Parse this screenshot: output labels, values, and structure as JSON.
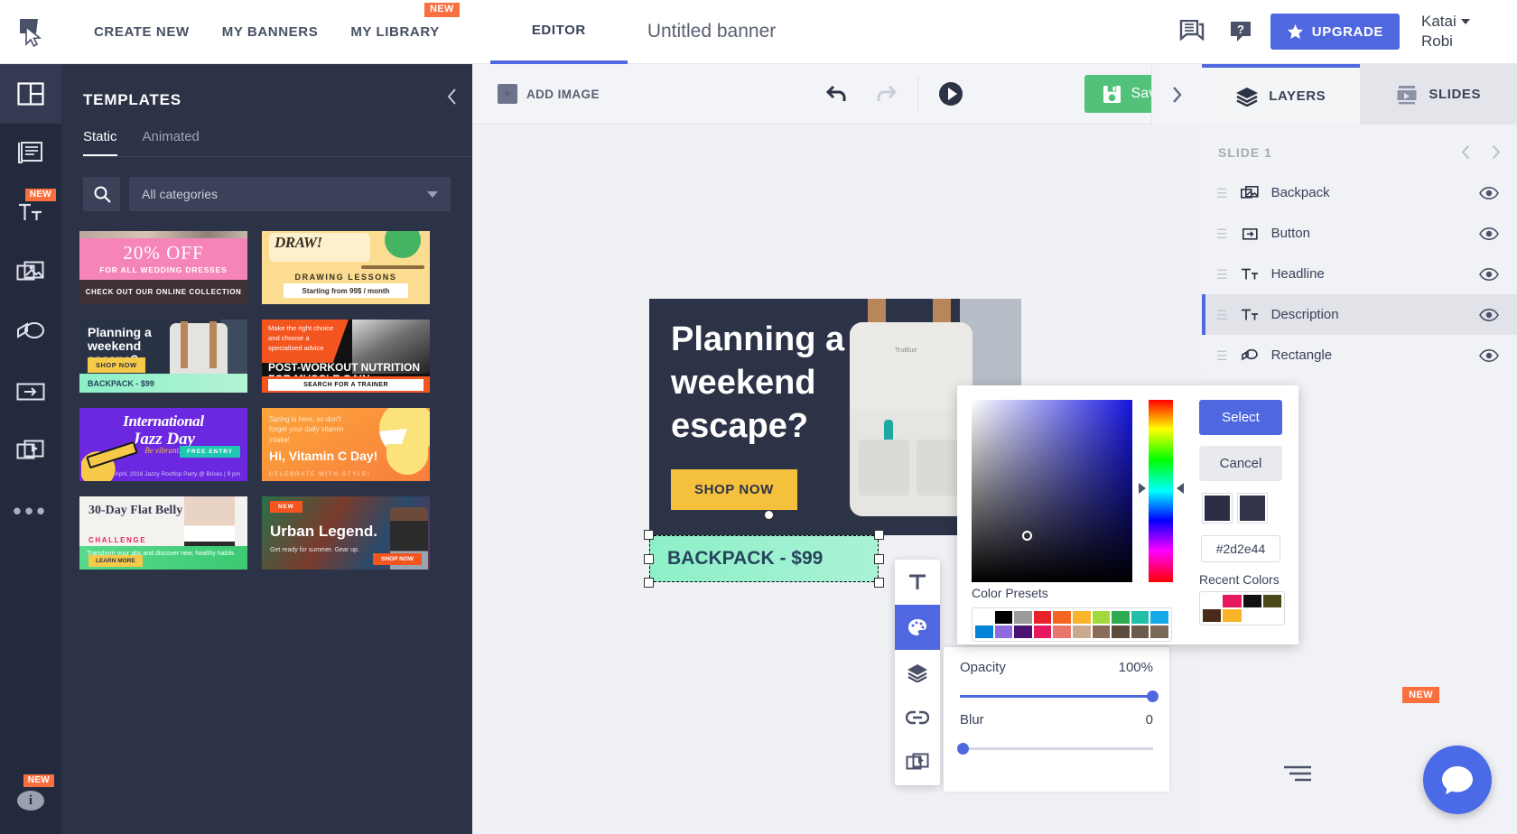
{
  "topbar": {
    "logo_icon": "cursor-logo-icon",
    "nav": [
      {
        "label": "CREATE NEW",
        "badge": ""
      },
      {
        "label": "MY BANNERS",
        "badge": ""
      },
      {
        "label": "MY LIBRARY",
        "badge": "NEW"
      }
    ],
    "editor_tab": "EDITOR",
    "banner_title": "Untitled banner",
    "feedback_icon": "feedback-icon",
    "help_icon": "help-icon",
    "upgrade_label": "UPGRADE",
    "user_first": "Katai",
    "user_last": "Robi"
  },
  "rail": {
    "items": [
      {
        "icon": "layout-icon",
        "badge": "",
        "active": true
      },
      {
        "icon": "text-block-icon",
        "badge": ""
      },
      {
        "icon": "text-tool-icon",
        "badge": "NEW"
      },
      {
        "icon": "image-icon",
        "badge": ""
      },
      {
        "icon": "shape-icon",
        "badge": ""
      },
      {
        "icon": "button-icon",
        "badge": ""
      },
      {
        "icon": "video-icon",
        "badge": ""
      },
      {
        "icon": "more-dots-icon",
        "badge": ""
      }
    ],
    "info_badge": "NEW",
    "info_icon": "info-icon"
  },
  "templates": {
    "title": "TEMPLATES",
    "collapse_icon": "chevron-left-icon",
    "tabs": [
      {
        "label": "Static",
        "active": true
      },
      {
        "label": "Animated",
        "active": false
      }
    ],
    "search_icon": "search-icon",
    "category_value": "All categories",
    "cards": [
      {
        "name": "wedding-dresses",
        "line1": "20% OFF",
        "line2": "FOR ALL WEDDING DRESSES",
        "line3": "CHECK OUT OUR ONLINE COLLECTION"
      },
      {
        "name": "drawing-lessons",
        "line1": "DRAW!",
        "line2": "DRAWING LESSONS",
        "line3": "Starting from 99$ / month"
      },
      {
        "name": "weekend-escape",
        "line1": "Planning a weekend escape?",
        "line2": "SHOP NOW",
        "line3": "BACKPACK - $99"
      },
      {
        "name": "post-workout",
        "line1": "Make the right choice and choose a specialised advice",
        "line2": "POST-WORKOUT NUTRITION FOR MUSCLE GAIN",
        "line3": "SEARCH FOR A TRAINER"
      },
      {
        "name": "jazz-day",
        "line1": "International",
        "line2": "Jazz Day",
        "line3": "Be vibrant. Celebrate with us",
        "line4": "FREE ENTRY",
        "line5": "30th April, 2018\nJazzy Rooftop Party\n@ Bricks | 9 pm"
      },
      {
        "name": "vitamin-c",
        "line1": "Spring is here, so don't forget your daily vitamin intake!",
        "line2": "Hi, Vitamin C Day!",
        "line3": "CELEBRATE WITH STYLE!"
      },
      {
        "name": "flat-belly",
        "line1": "30-Day Flat Belly",
        "line2": "CHALLENGE",
        "line3": "Transform your abs and discover new, healthy habits",
        "line4": "LEARN MORE"
      },
      {
        "name": "urban-legend",
        "line1": "NEW",
        "line2": "Urban Legend.",
        "line3": "Get ready for summer. Gear up.",
        "line4": "SHOP NOW"
      }
    ]
  },
  "editor": {
    "add_image_label": "ADD IMAGE",
    "undo_icon": "undo-icon",
    "redo_icon": "redo-icon",
    "preview_icon": "play-icon",
    "save_label": "Save",
    "save_icon": "save-disk-icon",
    "expand_icon": "chevron-right-icon",
    "canvas": {
      "headline": "Planning a weekend escape?",
      "cta": "SHOP NOW",
      "description": "BACKPACK - $99",
      "image_label": "TruBlue"
    },
    "element_toolbar": [
      {
        "icon": "text-icon",
        "active": false
      },
      {
        "icon": "palette-icon",
        "active": true
      },
      {
        "icon": "layers-icon",
        "active": false
      },
      {
        "icon": "link-icon",
        "active": false
      },
      {
        "icon": "animation-icon",
        "active": false
      }
    ]
  },
  "right_panel": {
    "tabs": [
      {
        "label": "LAYERS",
        "icon": "layers-icon",
        "active": true
      },
      {
        "label": "SLIDES",
        "icon": "slides-icon",
        "active": false
      }
    ],
    "slide_label": "SLIDE 1",
    "prev_icon": "chevron-left-icon",
    "next_icon": "chevron-right-icon",
    "layers": [
      {
        "name": "Backpack",
        "icon": "image-layer-icon",
        "selected": false,
        "visible": true
      },
      {
        "name": "Button",
        "icon": "button-layer-icon",
        "selected": false,
        "visible": true
      },
      {
        "name": "Headline",
        "icon": "text-layer-icon",
        "selected": false,
        "visible": true
      },
      {
        "name": "Description",
        "icon": "text-layer-icon",
        "selected": true,
        "visible": true
      },
      {
        "name": "Rectangle",
        "icon": "shape-layer-icon",
        "selected": false,
        "visible": true
      }
    ],
    "bottom_badge": "NEW",
    "align_icon": "align-icon",
    "chat_icon": "chat-icon"
  },
  "color_picker": {
    "select_label": "Select",
    "cancel_label": "Cancel",
    "hex_value": "#2d2e44",
    "presets_label": "Color Presets",
    "recent_label": "Recent Colors",
    "current_color": "#2d2e44",
    "previous_color": "#323349",
    "presets": [
      "#ffffff",
      "#000000",
      "#9b9b9b",
      "#e8212b",
      "#f4661f",
      "#f9b42a",
      "#a1d83c",
      "#2eab52",
      "#22bfa8",
      "#17a8e8",
      "#0083d6",
      "#8e6ce0",
      "#4a1271",
      "#e8185f",
      "#e8766b",
      "#c8ab8e",
      "#8a6c58",
      "#5d4b3c",
      "#6b5b4a",
      "#7a6957"
    ],
    "recents": [
      "#ffffff",
      "#e8185f",
      "#111111",
      "#4a4a18",
      "#4a2a18",
      "#f9b42a",
      "#ffffff",
      "#ffffff"
    ]
  },
  "properties": {
    "opacity_label": "Opacity",
    "opacity_value": "100%",
    "blur_label": "Blur",
    "blur_value": "0"
  }
}
